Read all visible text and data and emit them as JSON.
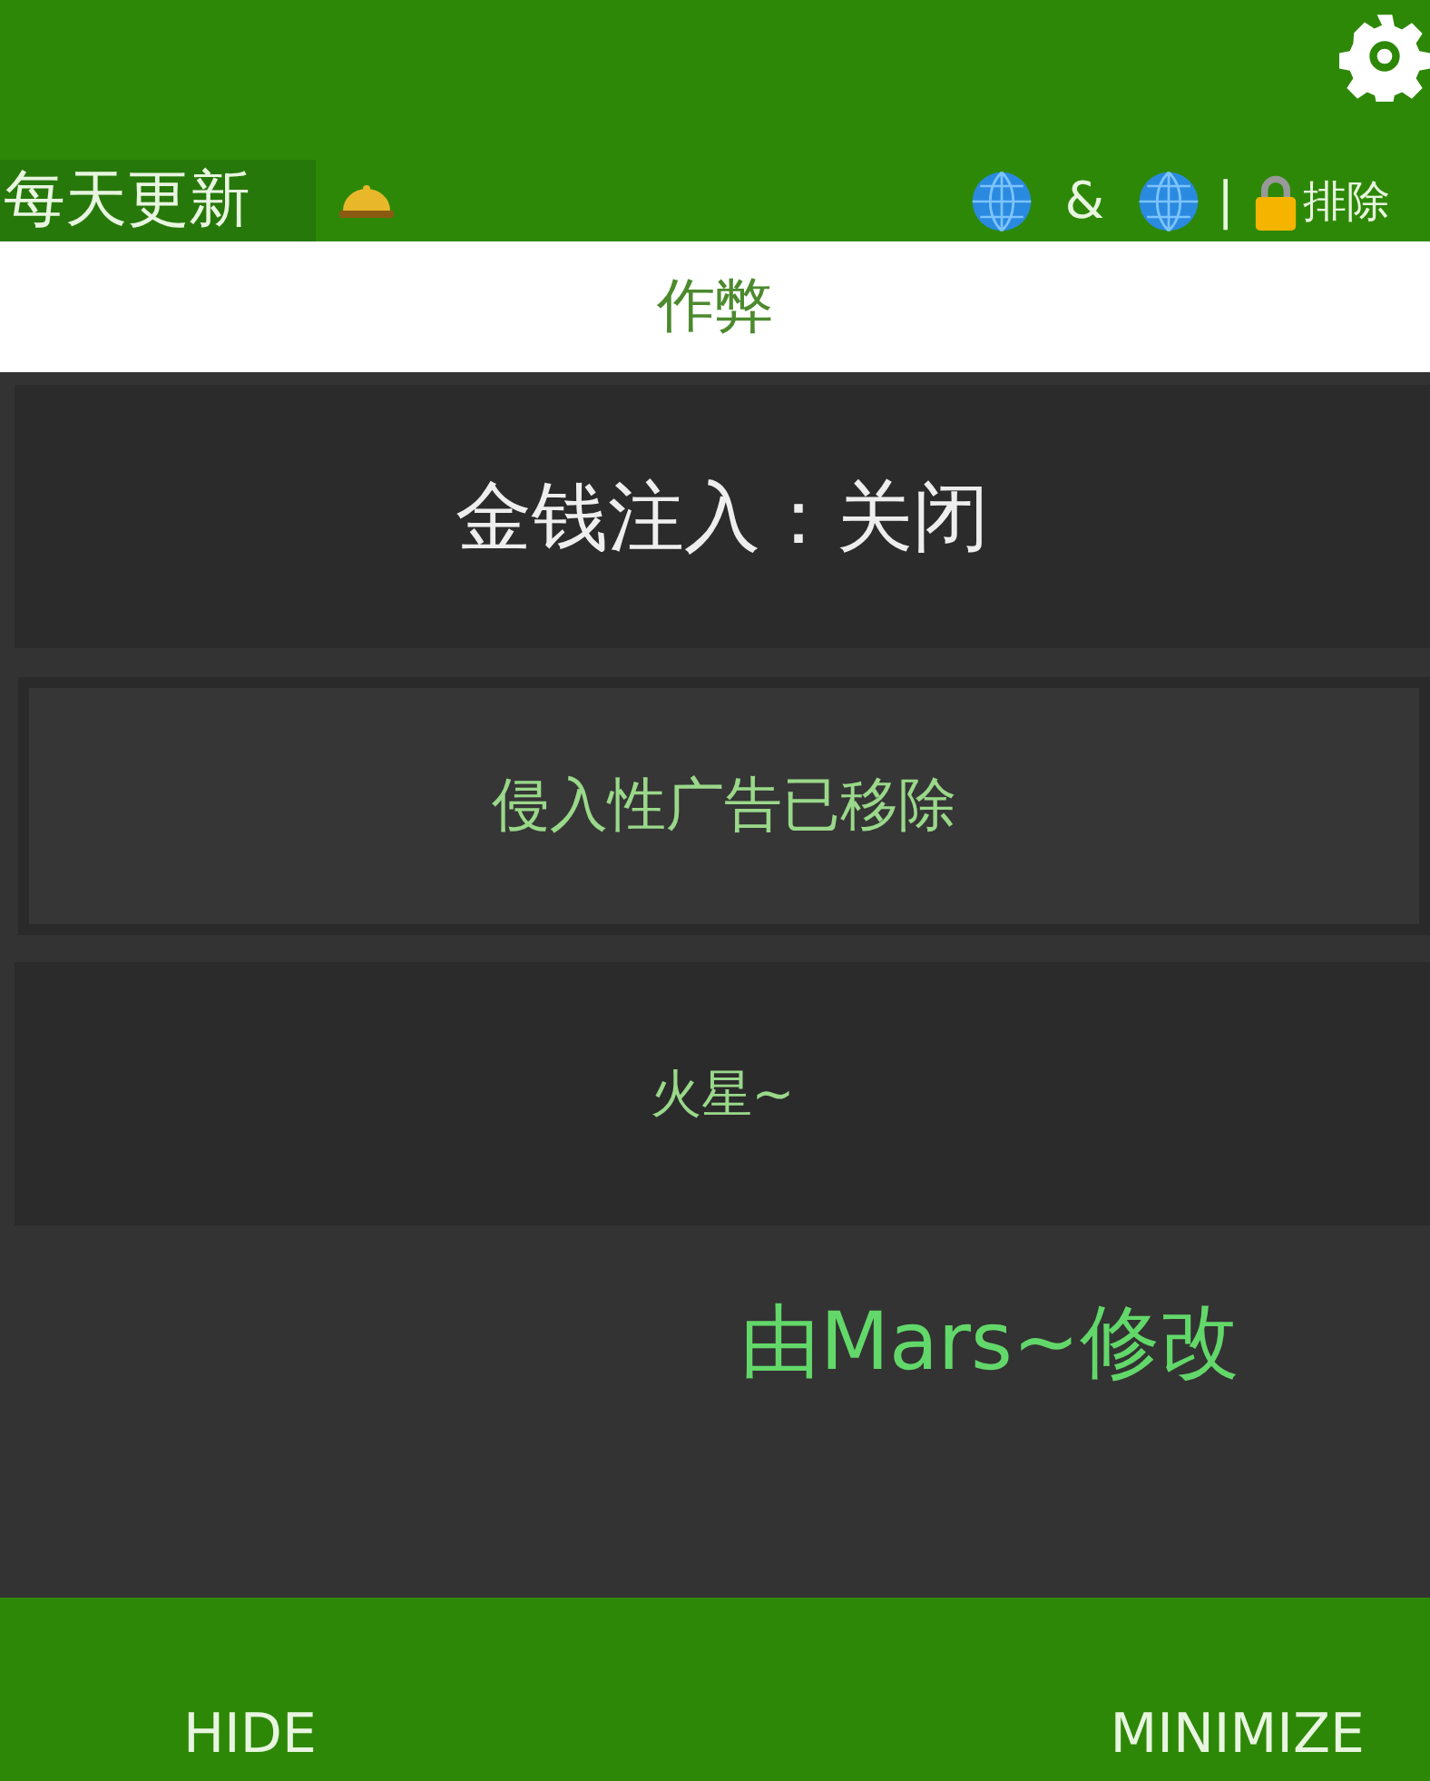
{
  "header": {
    "update_label": "每天更新",
    "links": [
      "&",
      "|"
    ],
    "exclude_label": "排除"
  },
  "tab": {
    "label": "作弊"
  },
  "items": [
    {
      "kind": "switch",
      "label": "金钱注入：关闭"
    },
    {
      "kind": "outlined",
      "label": "侵入性广告已移除"
    },
    {
      "kind": "plain",
      "label": "火星~"
    }
  ],
  "credit": "由Mars~修改",
  "buttons": [
    "HIDE",
    "MINIMIZE"
  ]
}
